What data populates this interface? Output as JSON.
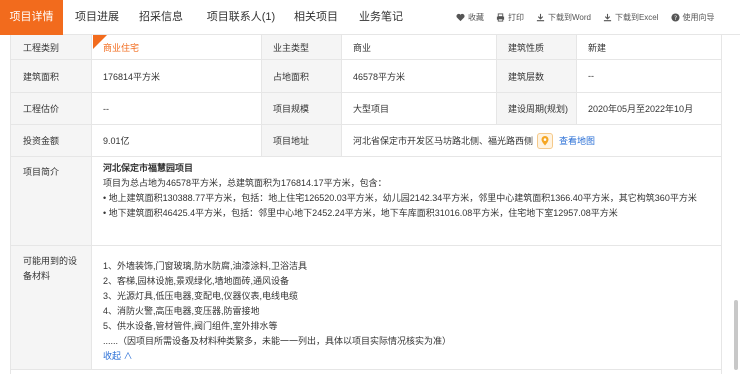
{
  "tabs": [
    {
      "label": "项目详情",
      "active": true
    },
    {
      "label": "项目进展"
    },
    {
      "label": "招采信息"
    },
    {
      "label": "项目联系人(1)"
    },
    {
      "label": "相关项目"
    },
    {
      "label": "业务笔记"
    }
  ],
  "toolbar": {
    "favorite": "收藏",
    "print": "打印",
    "download_word": "下载到Word",
    "download_excel": "下载到Excel",
    "guide": "使用向导"
  },
  "rows": {
    "r1": {
      "l1": "工程类别",
      "v1": "商业住宅",
      "l2": "业主类型",
      "v2": "商业",
      "l3": "建筑性质",
      "v3": "新建"
    },
    "r2": {
      "l1": "建筑面积",
      "v1": "176814平方米",
      "l2": "占地面积",
      "v2": "46578平方米",
      "l3": "建筑层数",
      "v3": "--"
    },
    "r3": {
      "l1": "工程估价",
      "v1": "--",
      "l2": "项目规模",
      "v2": "大型项目",
      "l3": "建设周期(规划)",
      "v3": "2020年05月至2022年10月"
    },
    "r4": {
      "l1": "投资金额",
      "v1": "9.01亿",
      "l2": "项目地址",
      "v2": "河北省保定市开发区马坊路北侧、福光路西侧",
      "map_link": "查看地图"
    }
  },
  "intro": {
    "label": "项目简介",
    "title": "河北保定市福慧园项目",
    "line1": "项目为总占地为46578平方米，总建筑面积为176814.17平方米，包含：",
    "line2": "• 地上建筑面积130388.77平方米，包括：地上住宅126520.03平方米，幼儿园2142.34平方米，邻里中心建筑面积1366.40平方米，其它构筑360平方米",
    "line3": "• 地下建筑面积46425.4平方米，包括：邻里中心地下2452.24平方米，地下车库面积31016.08平方米，住宅地下室12957.08平方米"
  },
  "equipment": {
    "label": "可能用到的设备材料",
    "items": [
      "1、外墙装饰,门窗玻璃,防水防腐,油漆涂料,卫浴洁具",
      "2、客梯,园林设施,景观绿化,墙地面砖,通风设备",
      "3、光源灯具,低压电器,变配电,仪器仪表,电线电缆",
      "4、消防火警,高压电器,变压器,防雷接地",
      "5、供水设备,管材管件,阀门组件,室外排水等",
      "......（因项目所需设备及材料种类繁多，未能一一列出，具体以项目实际情况核实为准）"
    ],
    "collapse": "收起 ∧"
  },
  "colors": {
    "accent": "#f26b1d",
    "link": "#2a6fd6",
    "label_bg": "#f5f5f5"
  }
}
